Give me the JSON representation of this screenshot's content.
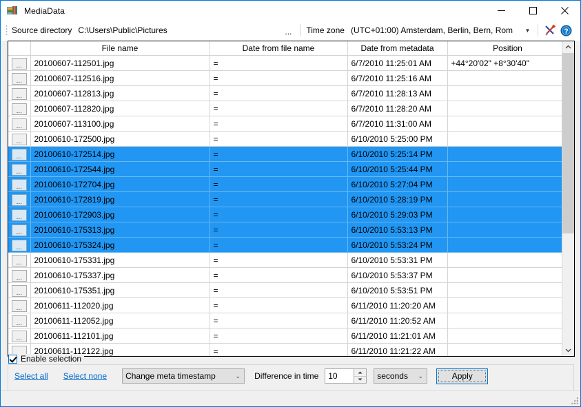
{
  "window": {
    "title": "MediaData",
    "app_icon": "media-photo-icon",
    "minimize_label": "Minimize",
    "maximize_label": "Maximize",
    "close_label": "Close"
  },
  "toolbar": {
    "source_directory_label": "Source directory",
    "source_directory_value": "C:\\Users\\Public\\Pictures",
    "browse_label": "...",
    "time_zone_label": "Time zone",
    "time_zone_value": "(UTC+01:00) Amsterdam, Berlin, Bern, Rom",
    "tools_icon": "tools-icon",
    "help_icon": "help-icon"
  },
  "grid": {
    "columns": [
      "",
      "File name",
      "Date from file name",
      "Date from metadata",
      "Position"
    ],
    "row_button_label": "...",
    "rows": [
      {
        "file_name": "20100607-112501.jpg",
        "date_from_file_name": "=",
        "date_from_metadata": "6/7/2010 11:25:01 AM",
        "position": "+44°20'02\" +8°30'40\"",
        "selected": false
      },
      {
        "file_name": "20100607-112516.jpg",
        "date_from_file_name": "=",
        "date_from_metadata": "6/7/2010 11:25:16 AM",
        "position": "",
        "selected": false
      },
      {
        "file_name": "20100607-112813.jpg",
        "date_from_file_name": "=",
        "date_from_metadata": "6/7/2010 11:28:13 AM",
        "position": "",
        "selected": false
      },
      {
        "file_name": "20100607-112820.jpg",
        "date_from_file_name": "=",
        "date_from_metadata": "6/7/2010 11:28:20 AM",
        "position": "",
        "selected": false
      },
      {
        "file_name": "20100607-113100.jpg",
        "date_from_file_name": "=",
        "date_from_metadata": "6/7/2010 11:31:00 AM",
        "position": "",
        "selected": false
      },
      {
        "file_name": "20100610-172500.jpg",
        "date_from_file_name": "=",
        "date_from_metadata": "6/10/2010 5:25:00 PM",
        "position": "",
        "selected": false
      },
      {
        "file_name": "20100610-172514.jpg",
        "date_from_file_name": "=",
        "date_from_metadata": "6/10/2010 5:25:14 PM",
        "position": "",
        "selected": true
      },
      {
        "file_name": "20100610-172544.jpg",
        "date_from_file_name": "=",
        "date_from_metadata": "6/10/2010 5:25:44 PM",
        "position": "",
        "selected": true
      },
      {
        "file_name": "20100610-172704.jpg",
        "date_from_file_name": "=",
        "date_from_metadata": "6/10/2010 5:27:04 PM",
        "position": "",
        "selected": true
      },
      {
        "file_name": "20100610-172819.jpg",
        "date_from_file_name": "=",
        "date_from_metadata": "6/10/2010 5:28:19 PM",
        "position": "",
        "selected": true
      },
      {
        "file_name": "20100610-172903.jpg",
        "date_from_file_name": "=",
        "date_from_metadata": "6/10/2010 5:29:03 PM",
        "position": "",
        "selected": true
      },
      {
        "file_name": "20100610-175313.jpg",
        "date_from_file_name": "=",
        "date_from_metadata": "6/10/2010 5:53:13 PM",
        "position": "",
        "selected": true
      },
      {
        "file_name": "20100610-175324.jpg",
        "date_from_file_name": "=",
        "date_from_metadata": "6/10/2010 5:53:24 PM",
        "position": "",
        "selected": true
      },
      {
        "file_name": "20100610-175331.jpg",
        "date_from_file_name": "=",
        "date_from_metadata": "6/10/2010 5:53:31 PM",
        "position": "",
        "selected": false
      },
      {
        "file_name": "20100610-175337.jpg",
        "date_from_file_name": "=",
        "date_from_metadata": "6/10/2010 5:53:37 PM",
        "position": "",
        "selected": false
      },
      {
        "file_name": "20100610-175351.jpg",
        "date_from_file_name": "=",
        "date_from_metadata": "6/10/2010 5:53:51 PM",
        "position": "",
        "selected": false
      },
      {
        "file_name": "20100611-112020.jpg",
        "date_from_file_name": "=",
        "date_from_metadata": "6/11/2010 11:20:20 AM",
        "position": "",
        "selected": false
      },
      {
        "file_name": "20100611-112052.jpg",
        "date_from_file_name": "=",
        "date_from_metadata": "6/11/2010 11:20:52 AM",
        "position": "",
        "selected": false
      },
      {
        "file_name": "20100611-112101.jpg",
        "date_from_file_name": "=",
        "date_from_metadata": "6/11/2010 11:21:01 AM",
        "position": "",
        "selected": false
      },
      {
        "file_name": "20100611-112122.jpg",
        "date_from_file_name": "=",
        "date_from_metadata": "6/11/2010 11:21:22 AM",
        "position": "",
        "selected": false
      }
    ]
  },
  "scrollbar": {
    "up_icon": "chevron-up-icon",
    "down_icon": "chevron-down-icon"
  },
  "bottom": {
    "enable_selection_label": "Enable selection",
    "enable_selection_checked": true,
    "select_all_label": "Select all",
    "select_none_label": "Select none",
    "action_value": "Change meta timestamp",
    "difference_label": "Difference in time",
    "difference_value": "10",
    "unit_value": "seconds",
    "apply_label": "Apply"
  },
  "colors": {
    "selection": "#2196f3",
    "accent": "#0078d7",
    "link": "#0066cc",
    "window_bg": "#f0f0f0"
  }
}
